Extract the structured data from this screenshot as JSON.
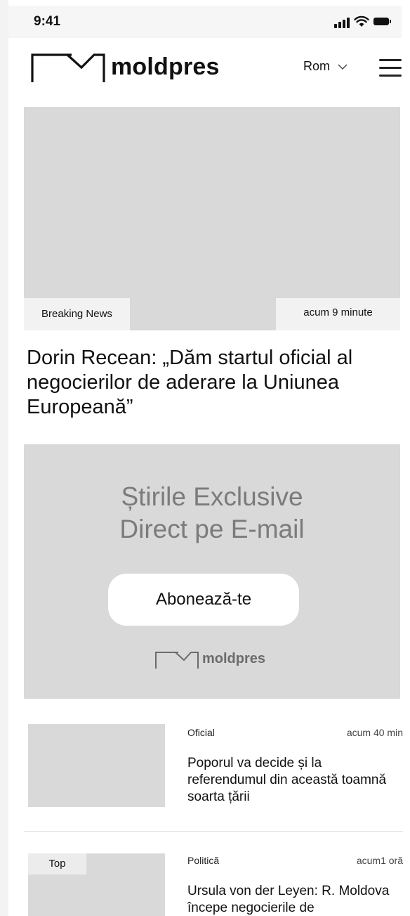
{
  "status_bar": {
    "time": "9:41"
  },
  "header": {
    "logo_text": "moldpres",
    "language": "Rom",
    "menu_icon": "hamburger-menu-icon"
  },
  "hero": {
    "tag": "Breaking News",
    "time": "acum 9 minute",
    "title": "Dorin Recean: „Dăm startul oficial al negocierilor de aderare la Uniunea Europeană”"
  },
  "promo": {
    "title_line1": "Știrile Exclusive",
    "title_line2": "Direct pe E-mail",
    "button_label": "Abonează-te",
    "logo_text": "moldpres"
  },
  "articles": [
    {
      "category": "Oficial",
      "time": "acum 40 min",
      "title": "Poporul va decide și la referendumul din această toamnă soarta țării",
      "tag": ""
    },
    {
      "category": "Politică",
      "time": "acum1 oră",
      "title": "Ursula von der Leyen: R. Moldova începe negocierile de",
      "tag": "Top"
    }
  ],
  "colors": {
    "placeholder_gray": "#d9d9d9",
    "promo_text_gray": "#7b7b7b",
    "text_dark": "#111111"
  }
}
